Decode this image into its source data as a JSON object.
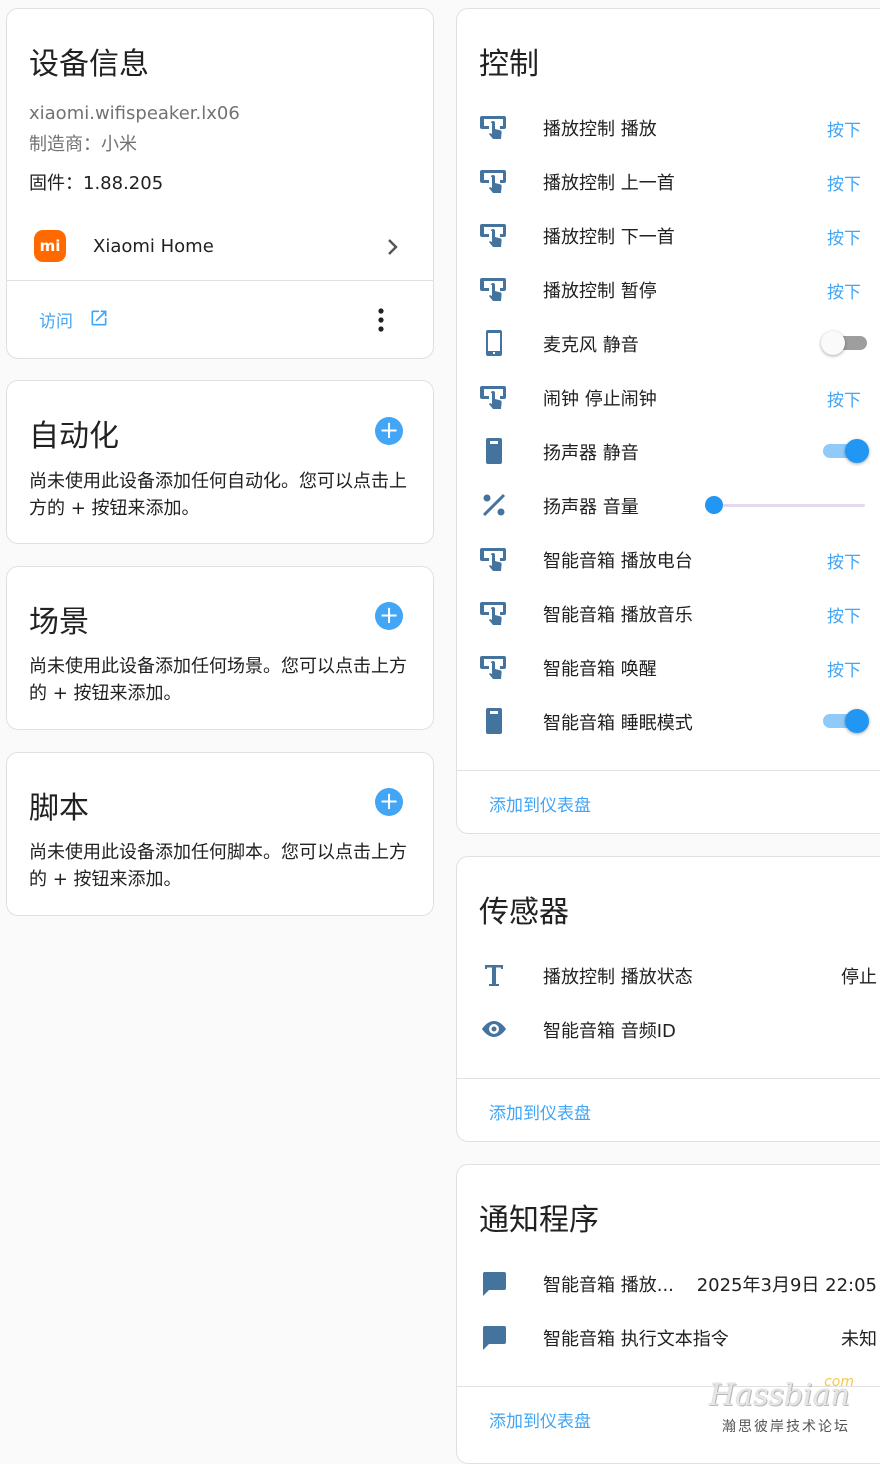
{
  "device_info": {
    "title": "设备信息",
    "model": "xiaomi.wifispeaker.lx06",
    "manufacturer": "制造商：小米",
    "firmware": "固件：1.88.205",
    "integration": {
      "logo_text": "mi",
      "name": "Xiaomi Home",
      "logo_color": "#ff6900"
    },
    "visit_label": "访问"
  },
  "automation": {
    "title": "自动化",
    "description": "尚未使用此设备添加任何自动化。您可以点击上方的 + 按钮来添加。"
  },
  "scene": {
    "title": "场景",
    "description": "尚未使用此设备添加任何场景。您可以点击上方的 + 按钮来添加。"
  },
  "script": {
    "title": "脚本",
    "description": "尚未使用此设备添加任何脚本。您可以点击上方的 + 按钮来添加。"
  },
  "controls": {
    "title": "控制",
    "items": [
      {
        "name": "播放控制 播放",
        "icon": "gesture-tap-button-icon",
        "action": "按下"
      },
      {
        "name": "播放控制 上一首",
        "icon": "gesture-tap-button-icon",
        "action": "按下"
      },
      {
        "name": "播放控制 下一首",
        "icon": "gesture-tap-button-icon",
        "action": "按下"
      },
      {
        "name": "播放控制 暂停",
        "icon": "gesture-tap-button-icon",
        "action": "按下"
      },
      {
        "name": "麦克风 静音",
        "icon": "cellphone-icon",
        "toggle": "off"
      },
      {
        "name": "闹钟 停止闹钟",
        "icon": "gesture-tap-button-icon",
        "action": "按下"
      },
      {
        "name": "扬声器 静音",
        "icon": "cellphone-solid-icon",
        "toggle": "on"
      },
      {
        "name": "扬声器 音量",
        "icon": "percent-icon",
        "slider_value": 0
      },
      {
        "name": "智能音箱 播放电台",
        "icon": "gesture-tap-button-icon",
        "action": "按下"
      },
      {
        "name": "智能音箱 播放音乐",
        "icon": "gesture-tap-button-icon",
        "action": "按下"
      },
      {
        "name": "智能音箱 唤醒",
        "icon": "gesture-tap-button-icon",
        "action": "按下"
      },
      {
        "name": "智能音箱 睡眠模式",
        "icon": "cellphone-solid-icon",
        "toggle": "on"
      }
    ],
    "add_label": "添加到仪表盘"
  },
  "sensors": {
    "title": "传感器",
    "items": [
      {
        "name": "播放控制 播放状态",
        "icon": "format-text-icon",
        "state": "停止"
      },
      {
        "name": "智能音箱 音频ID",
        "icon": "eye-icon",
        "state": ""
      }
    ],
    "add_label": "添加到仪表盘"
  },
  "notify": {
    "title": "通知程序",
    "items": [
      {
        "name": "智能音箱 播放...",
        "icon": "message-icon",
        "state": "2025年3月9日 22:05"
      },
      {
        "name": "智能音箱 执行文本指令",
        "icon": "message-icon",
        "state": "未知"
      }
    ],
    "add_label": "添加到仪表盘"
  },
  "watermark": {
    "brand": "Hassbian",
    "domain": "com",
    "subtitle": "瀚思彼岸技术论坛"
  },
  "colors": {
    "accent": "#42a5f5",
    "icon": "#44739e",
    "toggle_on": "#2196f3"
  }
}
